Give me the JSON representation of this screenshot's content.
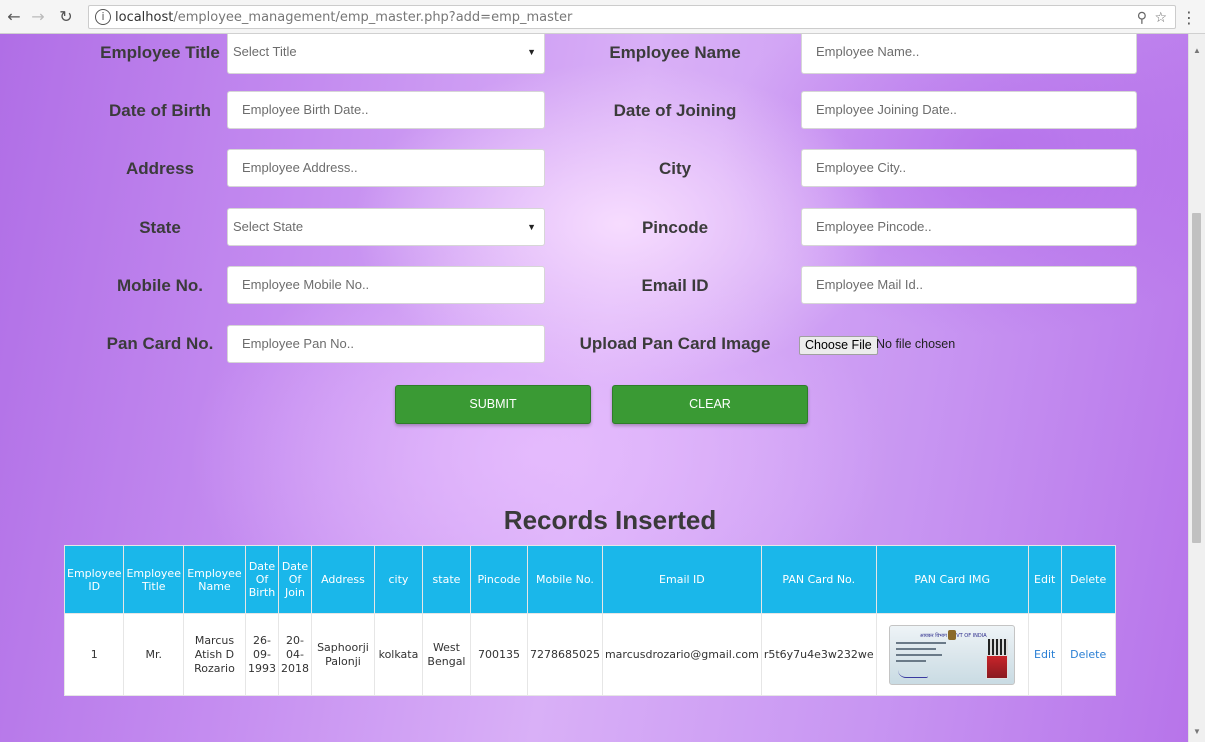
{
  "browser": {
    "back_icon": "arrow-left-icon",
    "forward_icon": "arrow-right-icon",
    "reload_icon": "reload-icon",
    "info_icon": "info-icon",
    "info_glyph": "i",
    "url_host": "localhost",
    "url_path": "/employee_management/emp_master.php?add=emp_master",
    "zoom_icon": "zoom-icon",
    "star_icon": "star-icon",
    "menu_icon": "menu-icon"
  },
  "form": {
    "employee_title": {
      "label": "Employee Title",
      "selected": "Select Title"
    },
    "employee_name": {
      "label": "Employee Name",
      "placeholder": "Employee Name.."
    },
    "date_of_birth": {
      "label": "Date of Birth",
      "placeholder": "Employee Birth Date.."
    },
    "date_of_joining": {
      "label": "Date of Joining",
      "placeholder": "Employee Joining Date.."
    },
    "address": {
      "label": "Address",
      "placeholder": "Employee Address.."
    },
    "city": {
      "label": "City",
      "placeholder": "Employee City.."
    },
    "state": {
      "label": "State",
      "selected": "Select State"
    },
    "pincode": {
      "label": "Pincode",
      "placeholder": "Employee Pincode.."
    },
    "mobile": {
      "label": "Mobile No.",
      "placeholder": "Employee Mobile No.."
    },
    "email": {
      "label": "Email ID",
      "placeholder": "Employee Mail Id.."
    },
    "pan": {
      "label": "Pan Card No.",
      "placeholder": "Employee Pan No.."
    },
    "upload": {
      "label": "Upload Pan Card Image",
      "button": "Choose File",
      "status": "No file chosen"
    },
    "submit_label": "SUBMIT",
    "clear_label": "CLEAR"
  },
  "records": {
    "title": "Records Inserted",
    "headers": {
      "id": "Employee ID",
      "title": "Employee Title",
      "name": "Employee Name",
      "dob": "Date Of Birth",
      "doj": "Date Of Join",
      "address": "Address",
      "city": "city",
      "state": "state",
      "pincode": "Pincode",
      "mobile": "Mobile No.",
      "email": "Email ID",
      "pan_no": "PAN Card No.",
      "pan_img": "PAN Card IMG",
      "edit": "Edit",
      "delete": "Delete"
    },
    "rows": [
      {
        "id": "1",
        "title": "Mr.",
        "name": "Marcus Atish D Rozario",
        "dob": "26-09-1993",
        "doj": "20-04-2018",
        "address": "Saphoorji Palonji",
        "city": "kolkata",
        "state": "West Bengal",
        "pincode": "700135",
        "mobile": "7278685025",
        "email": "marcusdrozario@gmail.com",
        "pan_no": "r5t6y7u4e3w232we",
        "pan_img_header": "आयकर विभाग GOVT OF INDIA",
        "edit": "Edit",
        "delete": "Delete"
      }
    ]
  }
}
